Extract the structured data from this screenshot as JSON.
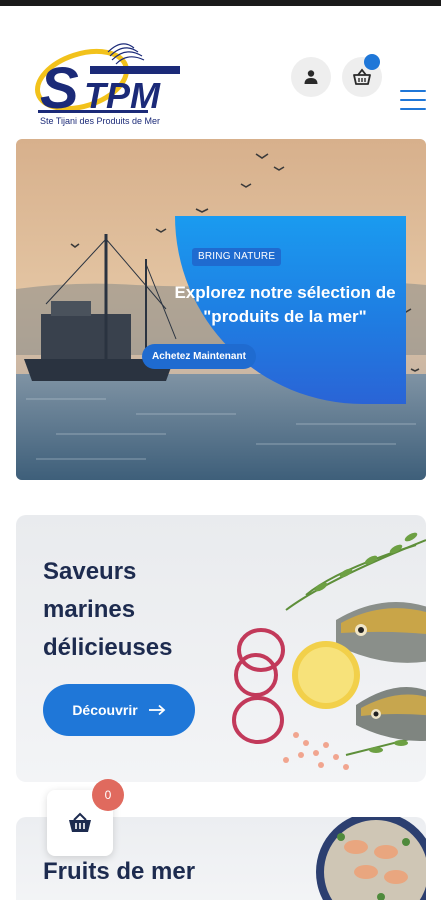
{
  "brand": {
    "logo_text": "STPM",
    "tagline": "Ste Tijani des Produits de Mer"
  },
  "header": {
    "user_icon": "user-icon",
    "cart_icon": "basket-icon",
    "menu_icon": "hamburger-icon"
  },
  "hero": {
    "badge": "BRING NATURE",
    "title": "Explorez notre sélection de \"produits de la mer\"",
    "cta": "Achetez Maintenant"
  },
  "promo1": {
    "title": "Saveurs marines délicieuses",
    "button": "Découvrir"
  },
  "promo2": {
    "title": "Fruits de mer"
  },
  "floating_cart": {
    "count": "0"
  },
  "colors": {
    "accent": "#1f77d8",
    "heading": "#1d2b4f",
    "badge_red": "#e06a5e"
  }
}
